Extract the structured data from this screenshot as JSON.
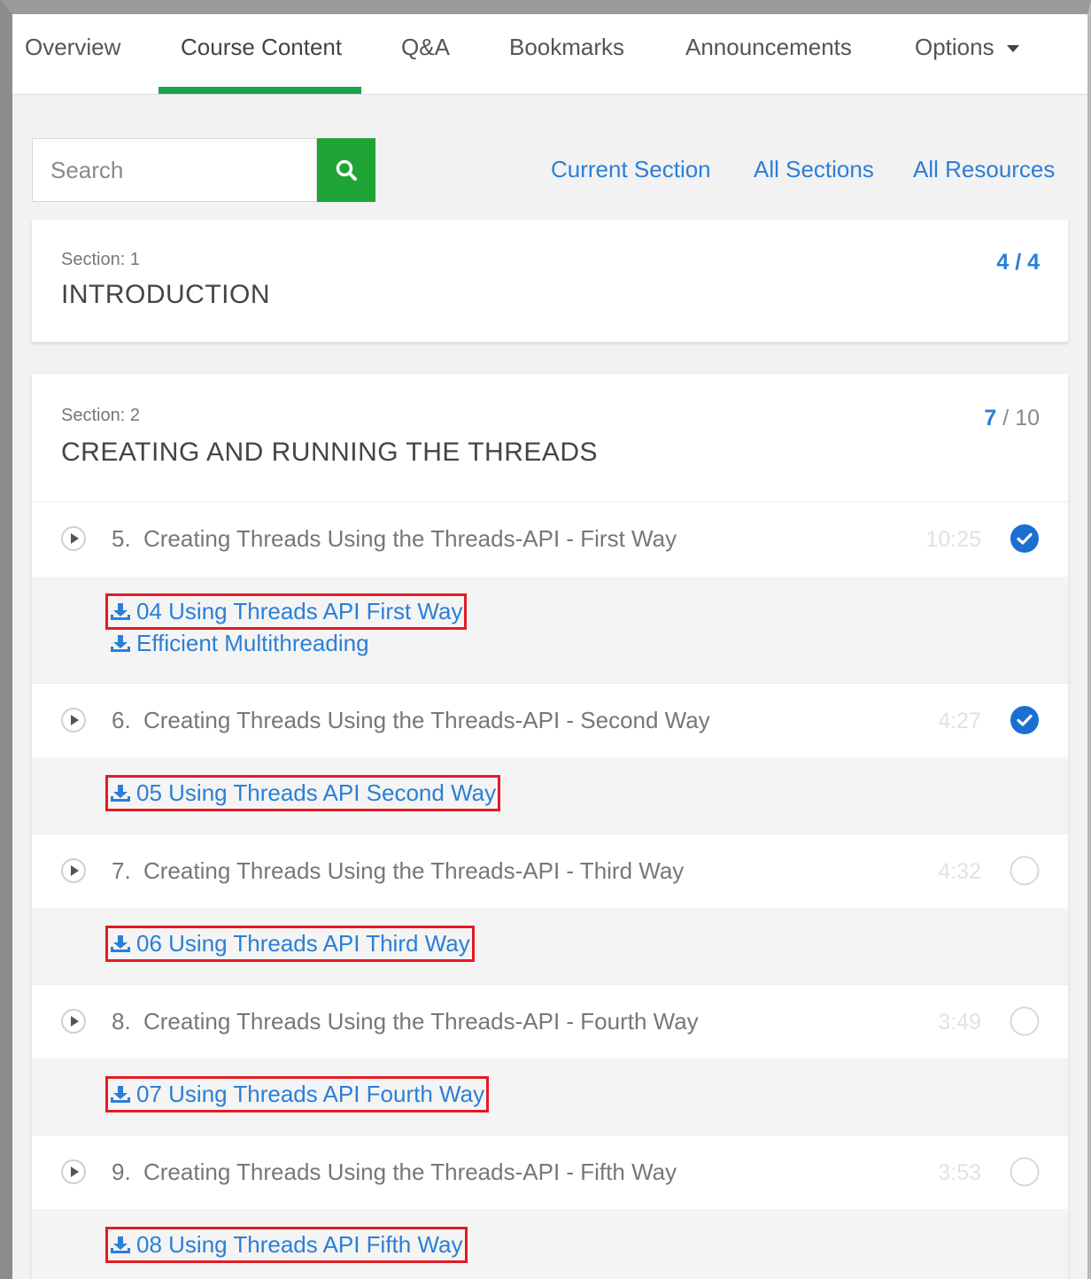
{
  "tabs": [
    {
      "label": "Overview"
    },
    {
      "label": "Course Content"
    },
    {
      "label": "Q&A"
    },
    {
      "label": "Bookmarks"
    },
    {
      "label": "Announcements"
    },
    {
      "label": "Options"
    }
  ],
  "active_tab": "Course Content",
  "search": {
    "placeholder": "Search"
  },
  "filters": {
    "current_section": "Current Section",
    "all_sections": "All Sections",
    "all_resources": "All Resources"
  },
  "section1": {
    "label": "Section: 1",
    "title": "INTRODUCTION",
    "completed": "4",
    "separator": "/",
    "total": "4"
  },
  "section2": {
    "label": "Section: 2",
    "title": "CREATING AND RUNNING THE THREADS",
    "completed": "7",
    "separator": "/",
    "total": "10",
    "lectures": [
      {
        "num": "5.",
        "title": "Creating Threads Using the Threads-API - First Way",
        "duration": "10:25",
        "completed": true,
        "resources": [
          "04 Using Threads API First Way",
          "Efficient Multithreading"
        ]
      },
      {
        "num": "6.",
        "title": "Creating Threads Using the Threads-API - Second Way",
        "duration": "4:27",
        "completed": true,
        "resources": [
          "05 Using Threads API Second Way"
        ]
      },
      {
        "num": "7.",
        "title": "Creating Threads Using the Threads-API - Third Way",
        "duration": "4:32",
        "completed": false,
        "resources": [
          "06 Using Threads API Third Way"
        ]
      },
      {
        "num": "8.",
        "title": "Creating Threads Using the Threads-API - Fourth Way",
        "duration": "3:49",
        "completed": false,
        "resources": [
          "07 Using Threads API Fourth Way"
        ]
      },
      {
        "num": "9.",
        "title": "Creating Threads Using the Threads-API - Fifth Way",
        "duration": "3:53",
        "completed": false,
        "resources": [
          "08 Using Threads API Fifth Way"
        ]
      }
    ]
  },
  "colors": {
    "accent_green": "#1aa34a",
    "link_blue": "#2b7fd6",
    "check_blue": "#1a6fd1",
    "annotation_red": "#e21b23"
  },
  "icons": {
    "search": "search-icon",
    "play": "play-circle-icon",
    "download": "download-icon",
    "completed": "check-circle-icon",
    "incomplete": "empty-circle-icon",
    "dropdown": "caret-down-icon"
  }
}
